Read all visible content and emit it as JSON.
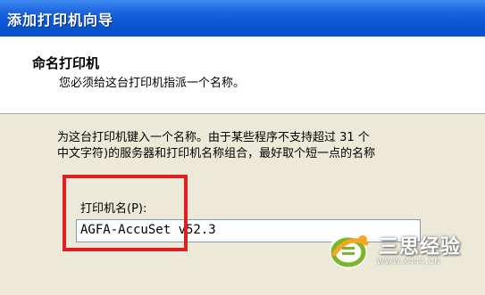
{
  "window": {
    "title": "添加打印机向导"
  },
  "header": {
    "title": "命名打印机",
    "subtitle": "您必须给这台打印机指派一个名称。"
  },
  "instructions": {
    "line1": "为这台打印机键入一个名称。由于某些程序不支持超过 31 个",
    "line2": "中文字符)的服务器和打印机名称组合，最好取个短一点的名称"
  },
  "printer_name": {
    "label": "打印机名(P):",
    "value": "AGFA-AccuSet v52.3"
  },
  "watermark": {
    "brand": "三思经验",
    "url": "WWW.X444.CN"
  },
  "colors": {
    "titlebar": "#0a4fc6",
    "highlight": "#e02020",
    "dialog_bg": "#ECE9D8",
    "watermark_green": "#7bb52a",
    "watermark_orange": "#f5a623"
  }
}
